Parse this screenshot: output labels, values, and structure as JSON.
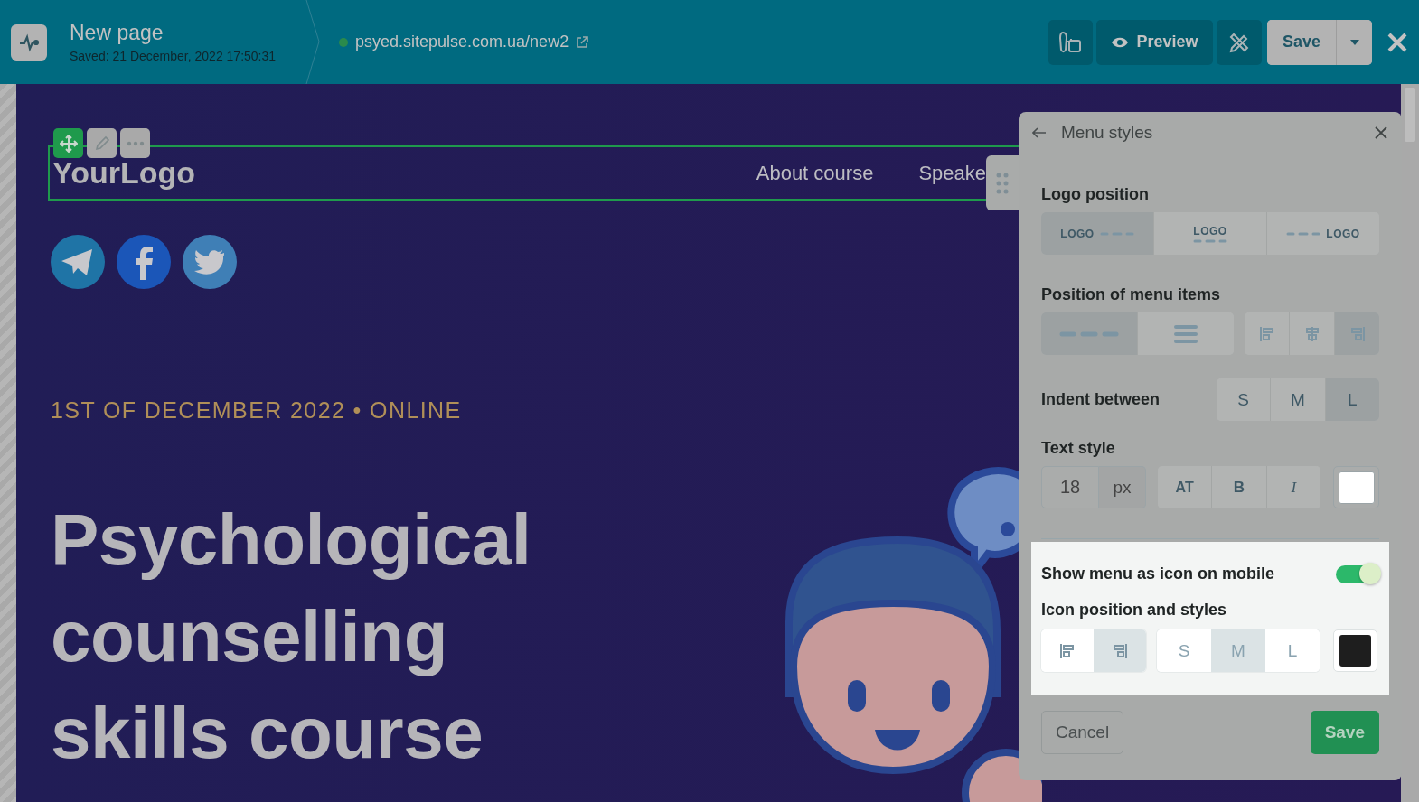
{
  "topbar": {
    "title": "New page",
    "saved": "Saved: 21 December, 2022 17:50:31",
    "url": "psyed.sitepulse.com.ua/new2",
    "published": true,
    "preview": "Preview",
    "save": "Save"
  },
  "canvas": {
    "logo": "YourLogo",
    "nav": [
      "About course",
      "Speake"
    ],
    "socials": [
      {
        "kind": "telegram",
        "color": "#1f74a6"
      },
      {
        "kind": "facebook",
        "color": "#1b56b8"
      },
      {
        "kind": "twitter",
        "color": "#3f7fb6"
      }
    ],
    "event_line": "1ST OF DECEMBER 2022 • ONLINE",
    "headline": [
      "Psychological",
      "counselling",
      "skills course"
    ]
  },
  "panel": {
    "title": "Menu styles",
    "logo_position": {
      "label": "Logo position",
      "options": [
        {
          "kind": "left",
          "text": "LOGO",
          "selected": true
        },
        {
          "kind": "center",
          "text": "LOGO",
          "selected": false
        },
        {
          "kind": "right",
          "text": "LOGO",
          "selected": false
        }
      ]
    },
    "menu_items_position": {
      "label": "Position of menu items",
      "layout": [
        {
          "kind": "inline",
          "selected": true
        },
        {
          "kind": "burger",
          "selected": false
        }
      ],
      "align": [
        {
          "kind": "left",
          "selected": false
        },
        {
          "kind": "center",
          "selected": false
        },
        {
          "kind": "right",
          "selected": true
        }
      ]
    },
    "indent": {
      "label": "Indent between",
      "options": [
        {
          "text": "S",
          "selected": false
        },
        {
          "text": "M",
          "selected": false
        },
        {
          "text": "L",
          "selected": true
        }
      ]
    },
    "text_style": {
      "label": "Text style",
      "size": "18",
      "unit": "px",
      "formats": [
        {
          "kind": "caps",
          "text": "AT",
          "selected": false
        },
        {
          "kind": "bold",
          "text": "B",
          "selected": false
        },
        {
          "kind": "italic",
          "text": "I",
          "selected": false
        }
      ],
      "color": "#ffffff"
    },
    "mobile": {
      "label": "Show menu as icon on mobile",
      "on": true,
      "styles_label": "Icon position and styles",
      "positions": [
        {
          "kind": "left",
          "selected": false
        },
        {
          "kind": "right",
          "selected": true
        }
      ],
      "sizes": [
        {
          "text": "S",
          "selected": false
        },
        {
          "text": "M",
          "selected": true
        },
        {
          "text": "L",
          "selected": false
        }
      ],
      "color": "#1e1e1e"
    },
    "cancel": "Cancel",
    "save": "Save"
  }
}
